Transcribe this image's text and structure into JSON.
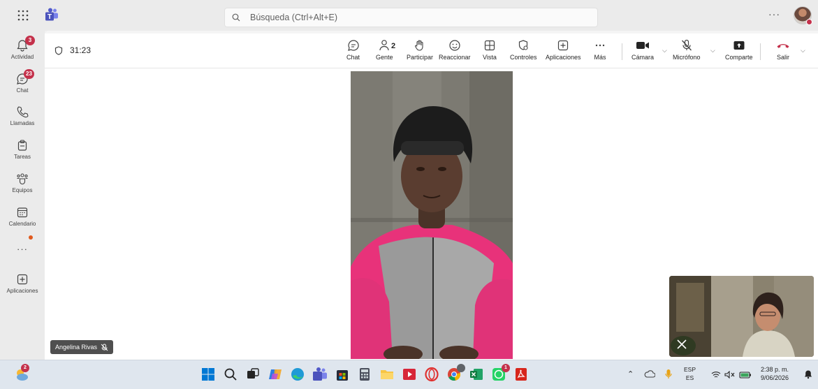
{
  "search": {
    "placeholder": "Búsqueda (Ctrl+Alt+E)"
  },
  "top": {
    "more": "···"
  },
  "rail": {
    "items": [
      {
        "label": "Actividad",
        "icon": "bell-icon",
        "badge": "3"
      },
      {
        "label": "Chat",
        "icon": "chat-icon",
        "badge": "23"
      },
      {
        "label": "Llamadas",
        "icon": "phone-icon",
        "badge": ""
      },
      {
        "label": "Tareas",
        "icon": "clipboard-icon",
        "badge": ""
      },
      {
        "label": "Equipos",
        "icon": "people-icon",
        "badge": ""
      },
      {
        "label": "Calendario",
        "icon": "calendar-icon",
        "badge": ""
      },
      {
        "label": "Aplicaciones",
        "icon": "plus-box-icon",
        "badge": ""
      }
    ],
    "more": "···"
  },
  "meeting": {
    "timer": "31:23",
    "controls": {
      "chat": "Chat",
      "people": "Gente",
      "people_count": "2",
      "raise": "Participar",
      "react": "Reaccionar",
      "view": "Vista",
      "controls": "Controles",
      "apps": "Aplicaciones",
      "more": "Más",
      "camera": "Cámara",
      "mic": "Micrófono",
      "share": "Comparte",
      "leave": "Salir"
    },
    "participant_name": "Angelina Rivas"
  },
  "taskbar": {
    "weather_badge": "2",
    "whatsapp_badge": "1",
    "chrome_badge": "",
    "lang_top": "ESP",
    "lang_bottom": "ES",
    "time": "2:38 p. m.",
    "date": "9/06/2026"
  },
  "colors": {
    "accent": "#5b5fc7",
    "badge": "#c4314b",
    "leave": "#c4314b"
  }
}
